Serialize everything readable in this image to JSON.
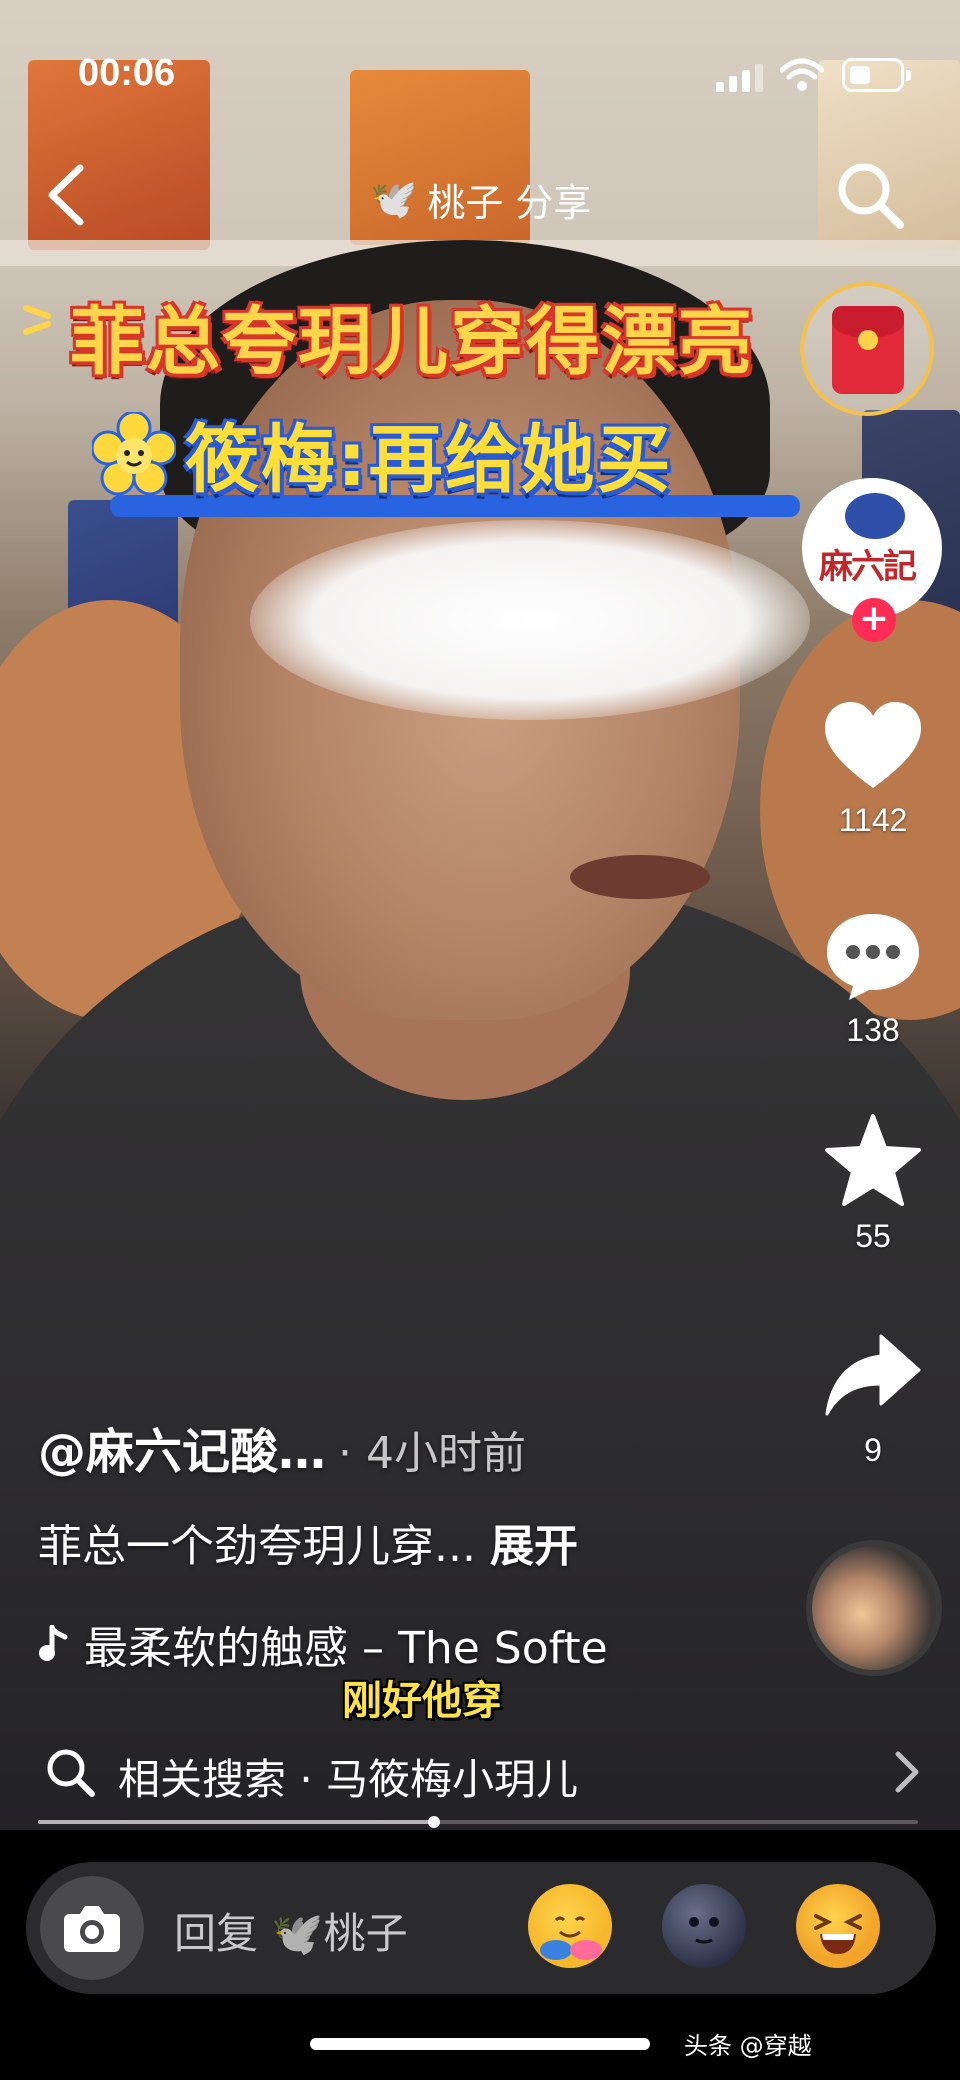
{
  "status_bar": {
    "time": "00:06"
  },
  "header": {
    "title": "桃子 分享",
    "poster_emoji": "🕊️"
  },
  "overlay": {
    "headline_line1": "菲总夸玥儿穿得漂亮",
    "headline_line2": "筱梅:再给她买"
  },
  "creator": {
    "avatar_text": "麻六記"
  },
  "actions": {
    "likes": "1142",
    "comments": "138",
    "favorites": "55",
    "shares": "9"
  },
  "post": {
    "author": "@麻六记酸…",
    "time_ago": "· 4小时前",
    "description": "菲总一个劲夸玥儿穿...",
    "expand_label": "展开",
    "music": "最柔软的触感 – The Softe"
  },
  "subtitle": "刚好他穿",
  "related_search": {
    "label": "相关搜索 · 马筱梅小玥儿"
  },
  "progress": {
    "played_fraction": 0.45
  },
  "reply": {
    "placeholder_prefix": "回复",
    "placeholder_name": "桃子"
  },
  "watermark": "头条 @穿越"
}
